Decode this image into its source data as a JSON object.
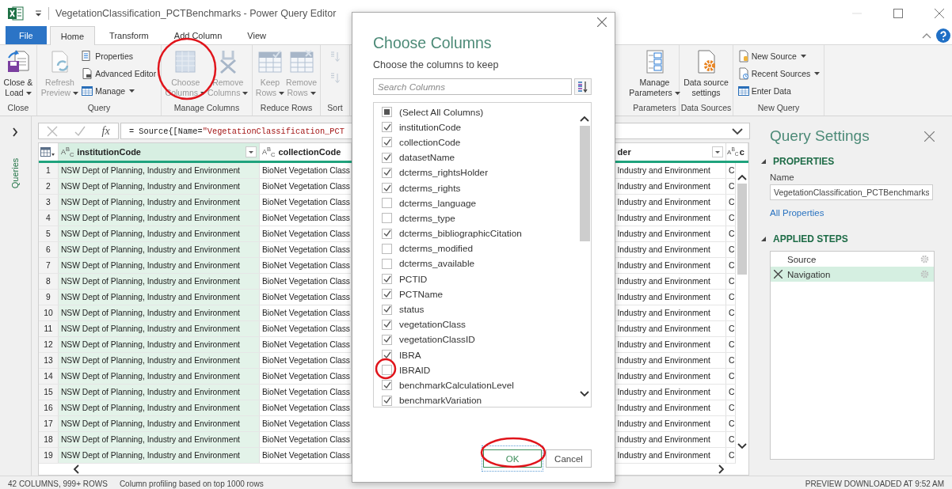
{
  "window": {
    "title": "VegetationClassification_PCTBenchmarks - Power Query Editor"
  },
  "ribbon_tabs": [
    {
      "label": "File",
      "kind": "file",
      "selected": false
    },
    {
      "label": "Home",
      "kind": "tab",
      "selected": true
    },
    {
      "label": "Transform",
      "kind": "tab",
      "selected": false
    },
    {
      "label": "Add Column",
      "kind": "tab",
      "selected": false
    },
    {
      "label": "View",
      "kind": "tab",
      "selected": false
    }
  ],
  "ribbon_groups": [
    {
      "label": "Close",
      "items": [
        {
          "kind": "large",
          "lines": [
            "Close &",
            "Load"
          ],
          "dropdown": true,
          "disabled": false
        }
      ]
    },
    {
      "label": "Query",
      "items": [
        {
          "kind": "large",
          "lines": [
            "Refresh",
            "Preview"
          ],
          "dropdown": true,
          "disabled": true
        },
        {
          "kind": "small",
          "lines": [
            "Properties"
          ],
          "dropdown": false,
          "disabled": false
        },
        {
          "kind": "small",
          "lines": [
            "Advanced Editor"
          ],
          "dropdown": false,
          "disabled": false
        },
        {
          "kind": "small",
          "lines": [
            "Manage"
          ],
          "dropdown": true,
          "disabled": false
        }
      ]
    },
    {
      "label": "Manage Columns",
      "items": [
        {
          "kind": "large",
          "lines": [
            "Choose",
            "Columns"
          ],
          "dropdown": true,
          "disabled": true
        },
        {
          "kind": "large",
          "lines": [
            "Remove",
            "Columns"
          ],
          "dropdown": true,
          "disabled": true
        }
      ]
    },
    {
      "label": "Reduce Rows",
      "items": [
        {
          "kind": "large",
          "lines": [
            "Keep",
            "Rows"
          ],
          "dropdown": true,
          "disabled": true
        },
        {
          "kind": "large",
          "lines": [
            "Remove",
            "Rows"
          ],
          "dropdown": true,
          "disabled": true
        }
      ]
    },
    {
      "label": "Sort",
      "items": [
        {
          "kind": "icon",
          "disabled": true
        },
        {
          "kind": "icon",
          "disabled": true
        }
      ]
    },
    {
      "label": "Parameters",
      "items": [
        {
          "kind": "large",
          "lines": [
            "Manage",
            "Parameters"
          ],
          "dropdown": true,
          "disabled": false
        }
      ]
    },
    {
      "label": "Data Sources",
      "items": [
        {
          "kind": "large",
          "lines": [
            "Data source",
            "settings"
          ],
          "dropdown": false,
          "disabled": false
        }
      ]
    },
    {
      "label": "New Query",
      "items": [
        {
          "kind": "small",
          "lines": [
            "New Source"
          ],
          "dropdown": true,
          "disabled": false
        },
        {
          "kind": "small",
          "lines": [
            "Recent Sources"
          ],
          "dropdown": true,
          "disabled": false
        },
        {
          "kind": "small",
          "lines": [
            "Enter Data"
          ],
          "dropdown": false,
          "disabled": false
        }
      ]
    }
  ],
  "queries_pane": {
    "label": "Queries",
    "expanded": false
  },
  "formula_bar": {
    "function_label": "fx",
    "code": "= Source{[Name=",
    "literal": "\"VegetationClassification_PCT"
  },
  "table": {
    "columns": [
      {
        "type": "A$^{B}$$_{C}$",
        "label": "institutionCode",
        "dropdown": true,
        "selected": true
      },
      {
        "type": "A$^{B}$$_{C}$",
        "label": "collectionCode",
        "dropdown": false,
        "selected": false
      },
      {
        "label": "der",
        "dropdown": true,
        "selected": false
      },
      {
        "type": "A$^{B}$$_{C}$",
        "label": "c",
        "dropdown": false,
        "selected": false
      }
    ],
    "rows": [
      {
        "number": "1",
        "cells": [
          "NSW Dept of Planning, Industry and Environment",
          "BioNet Vegetation Class",
          "Industry and Environment",
          "C"
        ]
      },
      {
        "number": "2",
        "cells": [
          "NSW Dept of Planning, Industry and Environment",
          "BioNet Vegetation Class",
          "Industry and Environment",
          "C"
        ]
      },
      {
        "number": "3",
        "cells": [
          "NSW Dept of Planning, Industry and Environment",
          "BioNet Vegetation Class",
          "Industry and Environment",
          "C"
        ]
      },
      {
        "number": "4",
        "cells": [
          "NSW Dept of Planning, Industry and Environment",
          "BioNet Vegetation Class",
          "Industry and Environment",
          "C"
        ]
      },
      {
        "number": "5",
        "cells": [
          "NSW Dept of Planning, Industry and Environment",
          "BioNet Vegetation Class",
          "Industry and Environment",
          "C"
        ]
      },
      {
        "number": "6",
        "cells": [
          "NSW Dept of Planning, Industry and Environment",
          "BioNet Vegetation Class",
          "Industry and Environment",
          "C"
        ]
      },
      {
        "number": "7",
        "cells": [
          "NSW Dept of Planning, Industry and Environment",
          "BioNet Vegetation Class",
          "Industry and Environment",
          "C"
        ]
      },
      {
        "number": "8",
        "cells": [
          "NSW Dept of Planning, Industry and Environment",
          "BioNet Vegetation Class",
          "Industry and Environment",
          "C"
        ]
      },
      {
        "number": "9",
        "cells": [
          "NSW Dept of Planning, Industry and Environment",
          "BioNet Vegetation Class",
          "Industry and Environment",
          "C"
        ]
      },
      {
        "number": "10",
        "cells": [
          "NSW Dept of Planning, Industry and Environment",
          "BioNet Vegetation Class",
          "Industry and Environment",
          "C"
        ]
      },
      {
        "number": "11",
        "cells": [
          "NSW Dept of Planning, Industry and Environment",
          "BioNet Vegetation Class",
          "Industry and Environment",
          "C"
        ]
      },
      {
        "number": "12",
        "cells": [
          "NSW Dept of Planning, Industry and Environment",
          "BioNet Vegetation Class",
          "Industry and Environment",
          "C"
        ]
      },
      {
        "number": "13",
        "cells": [
          "NSW Dept of Planning, Industry and Environment",
          "BioNet Vegetation Class",
          "Industry and Environment",
          "C"
        ]
      },
      {
        "number": "14",
        "cells": [
          "NSW Dept of Planning, Industry and Environment",
          "BioNet Vegetation Class",
          "Industry and Environment",
          "C"
        ]
      },
      {
        "number": "15",
        "cells": [
          "NSW Dept of Planning, Industry and Environment",
          "BioNet Vegetation Class",
          "Industry and Environment",
          "C"
        ]
      },
      {
        "number": "16",
        "cells": [
          "NSW Dept of Planning, Industry and Environment",
          "BioNet Vegetation Class",
          "Industry and Environment",
          "C"
        ]
      },
      {
        "number": "17",
        "cells": [
          "NSW Dept of Planning, Industry and Environment",
          "BioNet Vegetation Class",
          "Industry and Environment",
          "C"
        ]
      },
      {
        "number": "18",
        "cells": [
          "NSW Dept of Planning, Industry and Environment",
          "BioNet Vegetation Class",
          "Industry and Environment",
          "C"
        ]
      },
      {
        "number": "19",
        "cells": [
          "NSW Dept of Planning, Industry and Environment",
          "BioNet Vegetation Class",
          "Industry and Environment",
          "C"
        ]
      }
    ]
  },
  "query_settings": {
    "title": "Query Settings",
    "properties_heading": "PROPERTIES",
    "properties_expanded": true,
    "name_label": "Name",
    "name_value": "VegetationClassification_PCTBenchmarks",
    "all_properties": "All Properties",
    "steps_heading": "APPLIED STEPS",
    "steps_expanded": true,
    "steps": [
      {
        "label": "Source",
        "selected": false,
        "deletable": false
      },
      {
        "label": "Navigation",
        "selected": true,
        "deletable": true
      }
    ]
  },
  "dialog": {
    "title": "Choose Columns",
    "subtitle": "Choose the columns to keep",
    "search_placeholder": "Search Columns",
    "select_all": {
      "label": "(Select All Columns)",
      "indeterminate": true
    },
    "columns": [
      {
        "label": "institutionCode",
        "checked": true
      },
      {
        "label": "collectionCode",
        "checked": true
      },
      {
        "label": "datasetName",
        "checked": true
      },
      {
        "label": "dcterms_rightsHolder",
        "checked": true
      },
      {
        "label": "dcterms_rights",
        "checked": true
      },
      {
        "label": "dcterms_language",
        "checked": false
      },
      {
        "label": "dcterms_type",
        "checked": false
      },
      {
        "label": "dcterms_bibliographicCitation",
        "checked": true
      },
      {
        "label": "dcterms_modified",
        "checked": false
      },
      {
        "label": "dcterms_available",
        "checked": false
      },
      {
        "label": "PCTID",
        "checked": true
      },
      {
        "label": "PCTName",
        "checked": true
      },
      {
        "label": "status",
        "checked": true
      },
      {
        "label": "vegetationClass",
        "checked": true
      },
      {
        "label": "vegetationClassID",
        "checked": true
      },
      {
        "label": "IBRA",
        "checked": true
      },
      {
        "label": "IBRAID",
        "checked": false
      },
      {
        "label": "benchmarkCalculationLevel",
        "checked": true
      },
      {
        "label": "benchmarkVariation",
        "checked": true
      }
    ],
    "ok": "OK",
    "cancel": "Cancel"
  },
  "status_bar": {
    "columns": "42 COLUMNS, 999+ ROWS",
    "profiling": "Column profiling based on top 1000 rows",
    "preview": "PREVIEW DOWNLOADED AT 9:52 AM"
  }
}
